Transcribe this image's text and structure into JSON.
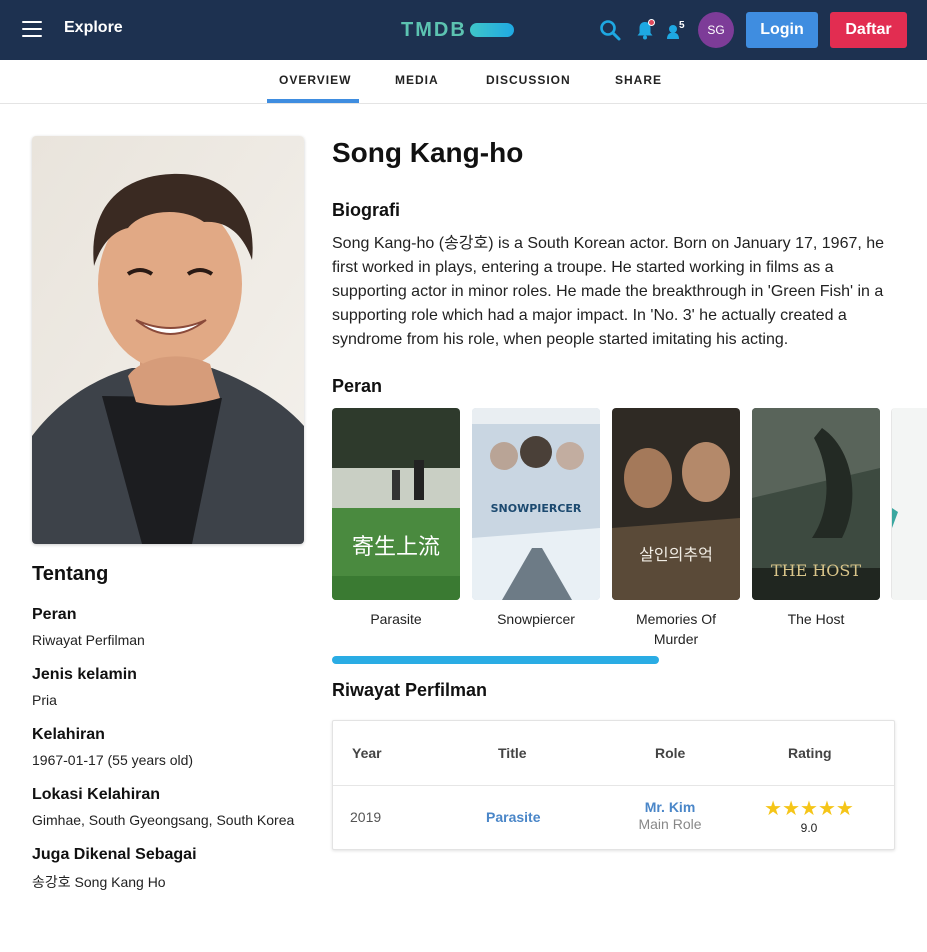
{
  "navbar": {
    "explore_label": "Explore",
    "logo_text": "TMDB",
    "notification_count": "5",
    "avatar_initials": "SG",
    "login_label": "Login",
    "register_label": "Daftar"
  },
  "tabs": [
    {
      "label": "OVERVIEW",
      "active": true
    },
    {
      "label": "MEDIA",
      "active": false
    },
    {
      "label": "DISCUSSION",
      "active": false
    },
    {
      "label": "SHARE",
      "active": false
    }
  ],
  "sidebar": {
    "title": "Tentang",
    "facts": [
      {
        "label": "Peran",
        "value": "Riwayat Perfilman"
      },
      {
        "label": "Jenis kelamin",
        "value": "Pria"
      },
      {
        "label": "Kelahiran",
        "value": "1967-01-17 (55 years old)"
      },
      {
        "label": "Lokasi Kelahiran",
        "value": "Gimhae, South Gyeongsang, South Korea"
      },
      {
        "label": "Juga Dikenal Sebagai",
        "value": "송강호 Song Kang Ho"
      }
    ]
  },
  "person": {
    "name": "Song Kang-ho",
    "bio_title": "Biografi",
    "bio": "Song Kang-ho (송강호) is a South Korean actor. Born on January 17, 1967, he first worked in plays, entering a troupe. He started working in films as a supporting actor in minor roles. He made the breakthrough in 'Green Fish' in a supporting role which had a major impact. In 'No. 3' he actually created a syndrome from his role, when people started imitating his acting."
  },
  "cast": {
    "title": "Peran",
    "items": [
      {
        "title": "Parasite",
        "poster_text": "寄生上流"
      },
      {
        "title": "Snowpiercer",
        "poster_text": "SNOWPIERCER"
      },
      {
        "title": "Memories Of Murder",
        "poster_text": "살인의추억"
      },
      {
        "title": "The Host",
        "poster_text": "THE HOST"
      }
    ]
  },
  "filmography": {
    "title": "Riwayat Perfilman",
    "headers": [
      "Year",
      "Title",
      "Role",
      "Rating"
    ],
    "rows": [
      {
        "year": "2019",
        "title": "Parasite",
        "character": "Mr. Kim",
        "role_type": "Main Role",
        "rating": "9.0",
        "stars": 5
      }
    ]
  },
  "colors": {
    "navbar_bg": "#1d3150",
    "accent_blue": "#3f8de0",
    "register_red": "#e22d51",
    "link_blue": "#4a86c8",
    "star_yellow": "#f5c518"
  }
}
